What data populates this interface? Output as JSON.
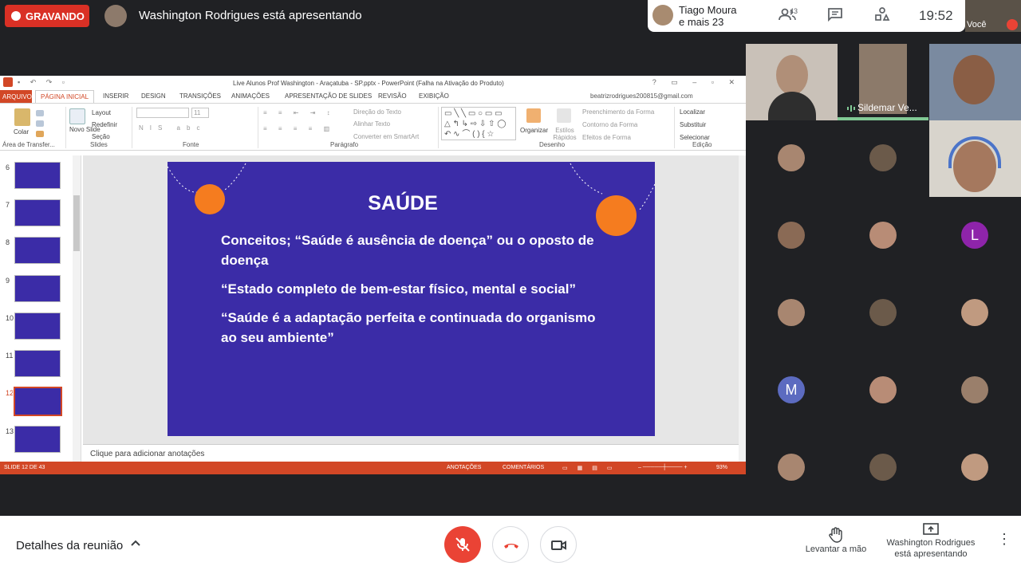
{
  "meet": {
    "recording_label": "GRAVANDO",
    "presenting_text": "Washington Rodrigues está apresentando",
    "other_presenter_line1": "Tiago Moura",
    "other_presenter_line2": "e mais 23",
    "participants_count": "43",
    "clock": "19:52",
    "self_label": "Você",
    "meeting_details": "Detalhes da reunião",
    "raise_hand": "Levantar a mão",
    "presenting_line1": "Washington Rodrigues",
    "presenting_line2": "está apresentando",
    "speaking_name": "Sildemar Ve...",
    "tiles": [
      {
        "type": "avatar"
      },
      {
        "type": "avatar"
      },
      {
        "type": "video"
      },
      {
        "type": "avatar"
      },
      {
        "type": "avatar"
      },
      {
        "type": "letter",
        "letter": "L",
        "color": "#8e24aa"
      },
      {
        "type": "avatar"
      },
      {
        "type": "avatar"
      },
      {
        "type": "avatar"
      },
      {
        "type": "letter",
        "letter": "M",
        "color": "#5c6bc0"
      },
      {
        "type": "avatar"
      },
      {
        "type": "avatar"
      },
      {
        "type": "avatar"
      },
      {
        "type": "avatar"
      },
      {
        "type": "avatar"
      }
    ]
  },
  "ppt": {
    "window_title": "Live Alunos Prof Washington - Araçatuba - SP.pptx - PowerPoint (Falha na Ativação do Produto)",
    "account": "beatrizrodrigues200815@gmail.com",
    "tabs": [
      "ARQUIVO",
      "PÁGINA INICIAL",
      "INSERIR",
      "DESIGN",
      "TRANSIÇÕES",
      "ANIMAÇÕES",
      "APRESENTAÇÃO DE SLIDES",
      "REVISÃO",
      "EXIBIÇÃO"
    ],
    "ribbon": {
      "paste": "Colar",
      "new_slide": "Novo Slide",
      "layout": "Layout",
      "reset": "Redefinir",
      "section": "Seção",
      "font_size": "11",
      "text_direction": "Direção do Texto",
      "align_text": "Alinhar Texto",
      "smartart": "Converter em SmartArt",
      "arrange": "Organizar",
      "quick_styles": "Estilos Rápidos",
      "shape_fill": "Preenchimento da Forma",
      "shape_outline": "Contorno da Forma",
      "shape_effects": "Efeitos de Forma",
      "find": "Localizar",
      "replace": "Substituir",
      "select": "Selecionar",
      "groups": [
        "Área de Transfer...",
        "Slides",
        "Fonte",
        "Parágrafo",
        "Desenho",
        "Edição"
      ]
    },
    "thumbnails": [
      "6",
      "7",
      "8",
      "9",
      "10",
      "11",
      "12",
      "13"
    ],
    "selected_slide": "12",
    "notes_placeholder": "Clique para adicionar anotações",
    "status": {
      "slide": "SLIDE 12 DE 43",
      "notes": "ANOTAÇÕES",
      "comments": "COMENTÁRIOS",
      "zoom": "93%"
    },
    "slide": {
      "title": "SAÚDE",
      "p1": "Conceitos; “Saúde é ausência de doença” ou o oposto de doença",
      "p2": "“Estado completo de bem-estar físico, mental e social”",
      "p3": "“Saúde é a adaptação perfeita e continuada do organismo ao seu ambiente”"
    }
  },
  "colors": {
    "slide_bg": "#3b2ca7",
    "ppt_accent": "#d24726",
    "meet_red": "#ea4335",
    "meet_bg": "#202124"
  }
}
